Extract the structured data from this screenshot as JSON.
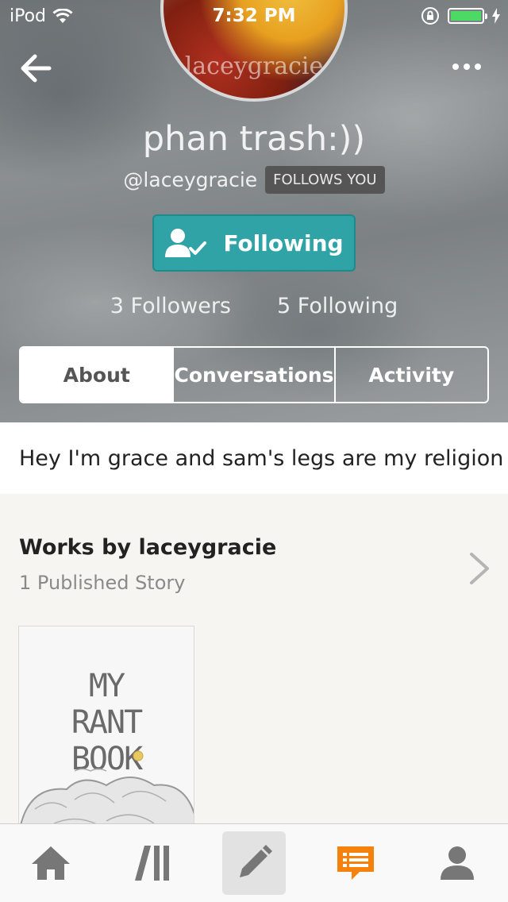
{
  "status_bar": {
    "carrier": "iPod",
    "time": "7:32 PM"
  },
  "profile": {
    "avatar_text": "laceygracie",
    "display_name": "phan trash:))",
    "handle": "@laceygracie",
    "follows_badge": "FOLLOWS YOU",
    "follow_button": "Following",
    "followers": "3 Followers",
    "following": "5 Following"
  },
  "tabs": [
    {
      "label": "About",
      "active": true
    },
    {
      "label": "Conversations",
      "active": false
    },
    {
      "label": "Activity",
      "active": false
    }
  ],
  "about": {
    "text": "Hey I'm grace and sam's legs are my religion"
  },
  "works": {
    "title": "Works by laceygracie",
    "count": "1 Published Story",
    "book_cover_text": "MY RANT BOOK"
  },
  "bottom_nav": [
    {
      "icon": "home-icon"
    },
    {
      "icon": "library-icon"
    },
    {
      "icon": "pencil-icon"
    },
    {
      "icon": "messages-icon"
    },
    {
      "icon": "profile-icon"
    }
  ],
  "colors": {
    "teal": "#2fa3a6",
    "orange": "#f5820d",
    "battery": "#4cd964"
  }
}
